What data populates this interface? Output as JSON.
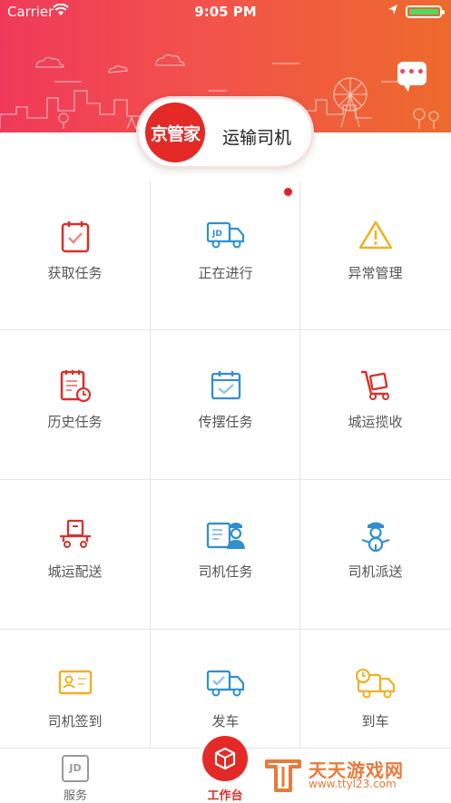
{
  "status_bar": {
    "carrier": "Carrier",
    "time": "9:05 PM"
  },
  "header": {
    "logo_text": "京管家",
    "role": "运输司机"
  },
  "grid": [
    {
      "label": "获取任务",
      "icon": "clipboard-check-icon",
      "color": "#d9302a"
    },
    {
      "label": "正在进行",
      "icon": "jd-truck-icon",
      "color": "#2e8fd3"
    },
    {
      "label": "异常管理",
      "icon": "warning-triangle-icon",
      "color": "#f0b020"
    },
    {
      "label": "历史任务",
      "icon": "document-clock-icon",
      "color": "#d9302a"
    },
    {
      "label": "传摆任务",
      "icon": "calendar-check-icon",
      "color": "#2e8fd3"
    },
    {
      "label": "城运揽收",
      "icon": "hand-truck-icon",
      "color": "#d9302a"
    },
    {
      "label": "城运配送",
      "icon": "delivery-cart-icon",
      "color": "#d9302a"
    },
    {
      "label": "司机任务",
      "icon": "driver-board-icon",
      "color": "#2e8fd3"
    },
    {
      "label": "司机派送",
      "icon": "driver-steering-icon",
      "color": "#2e8fd3"
    },
    {
      "label": "司机签到",
      "icon": "id-card-icon",
      "color": "#f0b020"
    },
    {
      "label": "发车",
      "icon": "truck-check-icon",
      "color": "#2e8fd3"
    },
    {
      "label": "到车",
      "icon": "truck-clock-icon",
      "color": "#f0b020"
    }
  ],
  "tabbar": {
    "service": "服务",
    "service_icon_text": "JD",
    "workbench": "工作台"
  },
  "watermark": {
    "title": "天天游戏网",
    "url": "www.ttyl23.com"
  },
  "colors": {
    "brand_red": "#e32a26",
    "header_start": "#f0395a",
    "header_end": "#ee6a2c"
  }
}
